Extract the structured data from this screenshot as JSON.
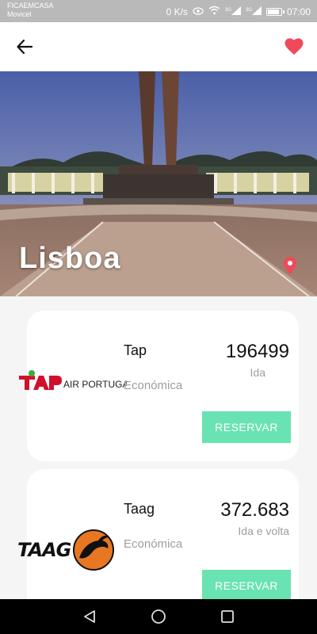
{
  "status_bar": {
    "carrier_line1": "FICAEMCASA",
    "carrier_line2": "Movicel",
    "network_speed": "0 K/s",
    "signal_label_1": "3G",
    "signal_label_2": "3G",
    "battery_level": 0.8,
    "time": "07:00"
  },
  "header": {
    "back_icon": "arrow-back-icon",
    "favorite_icon": "heart-icon",
    "favorite_color": "#f0495a"
  },
  "destination": {
    "name": "Lisboa",
    "location_icon": "map-pin-icon",
    "pin_color": "#f0495a"
  },
  "offers": [
    {
      "airline": "Tap",
      "logo_text": "AIR PORTUGAL",
      "logo_icon": "tap-logo-icon",
      "fare_class": "Económica",
      "price": "196499",
      "trip_type": "Ida",
      "button_label": "RESERVAR"
    },
    {
      "airline": "Taag",
      "logo_text": "TAAG",
      "logo_icon": "taag-logo-icon",
      "fare_class": "Económica",
      "price": "372.683",
      "trip_type": "Ida e volta",
      "button_label": "RESERVAR"
    }
  ],
  "theme": {
    "accent": "#69e3b1",
    "muted_text": "#9e9e9e"
  }
}
